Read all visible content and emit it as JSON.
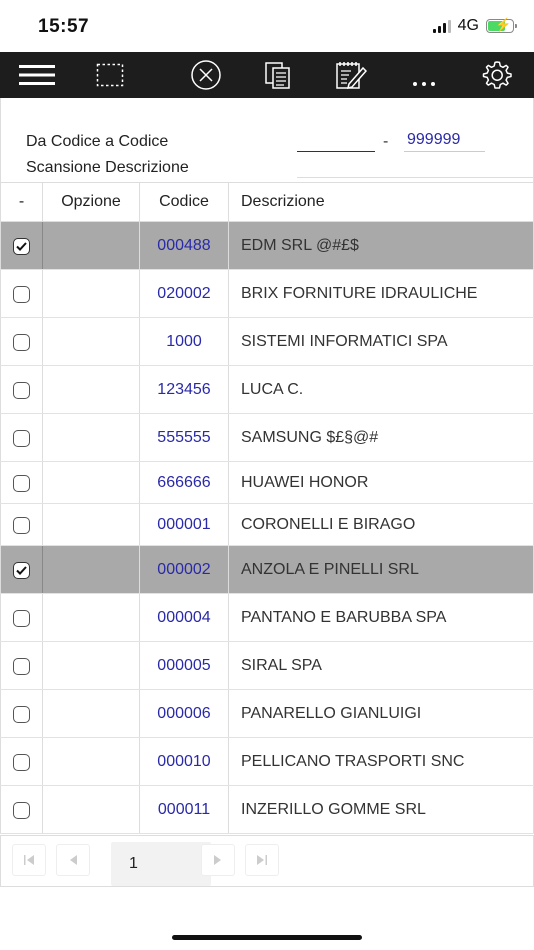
{
  "status_bar": {
    "time": "15:57",
    "network": "4G"
  },
  "toolbar": {
    "icons": [
      "menu-icon",
      "select-area-icon",
      "close-circle-icon",
      "copy-icon",
      "edit-note-icon",
      "more-icon",
      "gear-icon"
    ],
    "more_label": "..."
  },
  "filters": {
    "range_label": "Da Codice a Codice",
    "range_from_value": "",
    "range_separator": "-",
    "range_to_value": "999999",
    "desc_label": "Scansione Descrizione",
    "desc_value": ""
  },
  "table": {
    "columns": [
      "-",
      "Opzione",
      "Codice",
      "Descrizione"
    ],
    "rows": [
      {
        "checked": true,
        "option": "",
        "code": "000488",
        "description": "EDM SRL @#£$"
      },
      {
        "checked": false,
        "option": "",
        "code": "020002",
        "description": "BRIX FORNITURE IDRAULICHE"
      },
      {
        "checked": false,
        "option": "",
        "code": "1000",
        "description": "SISTEMI INFORMATICI SPA"
      },
      {
        "checked": false,
        "option": "",
        "code": "123456",
        "description": "LUCA C."
      },
      {
        "checked": false,
        "option": "",
        "code": "555555",
        "description": "SAMSUNG $£§@#"
      },
      {
        "checked": false,
        "option": "",
        "code": "666666",
        "description": "HUAWEI HONOR"
      },
      {
        "checked": false,
        "option": "",
        "code": "000001",
        "description": "CORONELLI E BIRAGO"
      },
      {
        "checked": true,
        "option": "",
        "code": "000002",
        "description": "ANZOLA E PINELLI SRL"
      },
      {
        "checked": false,
        "option": "",
        "code": "000004",
        "description": "PANTANO E BARUBBA SPA"
      },
      {
        "checked": false,
        "option": "",
        "code": "000005",
        "description": "SIRAL SPA"
      },
      {
        "checked": false,
        "option": "",
        "code": "000006",
        "description": "PANARELLO GIANLUIGI"
      },
      {
        "checked": false,
        "option": "",
        "code": "000010",
        "description": "PELLICANO TRASPORTI SNC"
      },
      {
        "checked": false,
        "option": "",
        "code": "000011",
        "description": "INZERILLO GOMME SRL"
      }
    ]
  },
  "pager": {
    "current_page": "1"
  }
}
